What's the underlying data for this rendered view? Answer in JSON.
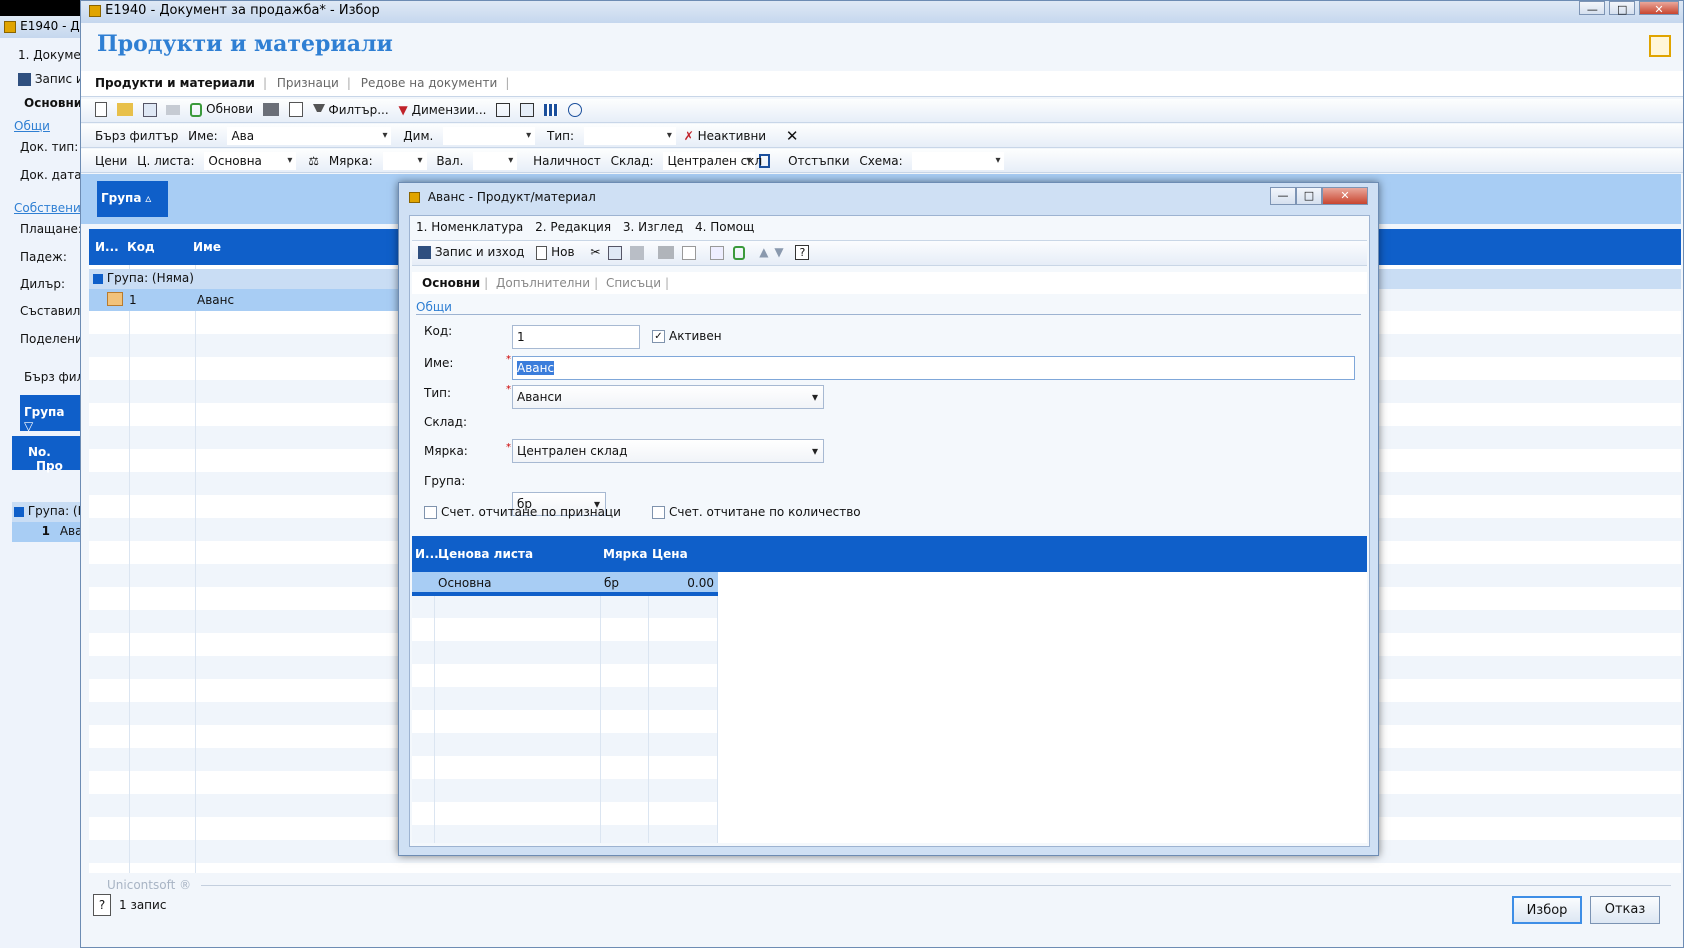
{
  "bg_window": {
    "title": "E1940 - Д",
    "menu_item": "1. Докумен",
    "save": "Запис и",
    "tab": "Основни",
    "section_general": "Общи",
    "doc_type": "Док. тип:",
    "doc_date": "Док. дата:",
    "section_own": "Собствени",
    "payment": "Плащане:",
    "due": "Падеж:",
    "dealer": "Дилър:",
    "author": "Съставил:",
    "division": "Поделени",
    "quick_filter": "Бърз филт",
    "group": "Група",
    "col_no": "No.",
    "col_pr": "Про",
    "group_row": "Група: (Н",
    "row_no": "1",
    "row_name": "Ава"
  },
  "main_window": {
    "title": "E1940 - Документ за продажба* - Избор",
    "heading": "Продукти и материали",
    "tabs": [
      "Продукти и материали",
      "Признаци",
      "Редове на документи"
    ],
    "toolbar1": {
      "refresh": "Обнови",
      "filter": "Филтър...",
      "dimensions": "Димензии..."
    },
    "toolbar2": {
      "quick_filter": "Бърз филтър",
      "name_label": "Име:",
      "name_value": "Ава",
      "dim_label": "Дим.",
      "type_label": "Тип:",
      "inactive": "Неактивни"
    },
    "toolbar3": {
      "prices": "Цени",
      "price_list_label": "Ц. листа:",
      "price_list_value": "Основна",
      "unit_label": "Мярка:",
      "currency_label": "Вал.",
      "availability": "Наличност",
      "warehouse_label": "Склад:",
      "warehouse_value": "Централен скл",
      "discounts": "Отстъпки",
      "scheme_label": "Схема:"
    },
    "group_chip": "Група",
    "columns": [
      "И...",
      "Код",
      "Име"
    ],
    "group_row": "Група: (Няма)",
    "rows": [
      {
        "code": "1",
        "name": "Аванс"
      }
    ],
    "watermark": "Unicontsoft ®",
    "status": "1 запис",
    "select_button": "Избор",
    "cancel_button": "Отказ"
  },
  "dialog": {
    "title": "Аванс - Продукт/материал",
    "menu": [
      "1. Номенклатура",
      "2. Редакция",
      "3. Изглед",
      "4. Помощ"
    ],
    "save_exit": "Запис и изход",
    "new": "Нов",
    "tabs": [
      "Основни",
      "Допълнителни",
      "Списъци"
    ],
    "section": "Общи",
    "fields": {
      "code_label": "Код:",
      "code_value": "1",
      "active_label": "Активен",
      "name_label": "Име:",
      "name_value": "Аванс",
      "type_label": "Тип:",
      "type_value": "Аванси",
      "warehouse_label": "Склад:",
      "warehouse_value": "Централен склад",
      "unit_label": "Мярка:",
      "unit_value": "бр",
      "group_label": "Група:",
      "group_value": ""
    },
    "check_features": "Счет. отчитане по признаци",
    "check_quantity": "Счет. отчитане по количество",
    "grid_columns": [
      "И...",
      "Ценова листа",
      "Мярка",
      "Цена"
    ],
    "grid_rows": [
      {
        "list": "Основна",
        "unit": "бр",
        "price": "0.00"
      }
    ]
  },
  "colors": {
    "accent": "#0f5fc9",
    "heading": "#2f7fd3",
    "selection": "#a8cdf4"
  }
}
